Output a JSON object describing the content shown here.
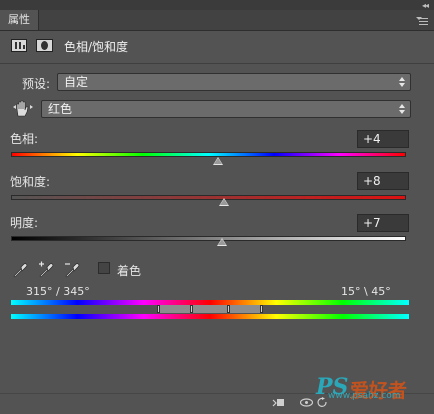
{
  "panel": {
    "tab_label": "属性",
    "title": "色相/饱和度"
  },
  "preset": {
    "label": "预设:",
    "value": "自定"
  },
  "channel": {
    "value": "红色"
  },
  "hue": {
    "label": "色相:",
    "value": "+4",
    "level": 0.525
  },
  "saturation": {
    "label": "饱和度:",
    "value": "+8",
    "level": 0.54
  },
  "lightness": {
    "label": "明度:",
    "value": "+7",
    "level": 0.535
  },
  "colorize": {
    "label": "着色",
    "checked": false
  },
  "range": {
    "left_text": "315° / 345°",
    "right_text": "15° \\ 45°"
  },
  "watermark": {
    "logo": "PS爱好者",
    "url": "www.psahz.com"
  },
  "colors": {
    "panel_bg": "#535353",
    "tab_bg": "#424242",
    "saturation_start": "#555555",
    "saturation_end": "#dd1111"
  },
  "icons": {
    "adjustment": "hue-saturation-adjustment-icon",
    "mask": "layer-mask-icon",
    "hand": "targeted-adjustment-hand-icon",
    "eyedroppers": [
      "eyedropper-icon",
      "eyedropper-plus-icon",
      "eyedropper-minus-icon"
    ],
    "bottom": [
      "clip-to-layer-icon",
      "view-previous-icon",
      "reset-icon",
      "visibility-icon",
      "delete-icon"
    ]
  }
}
